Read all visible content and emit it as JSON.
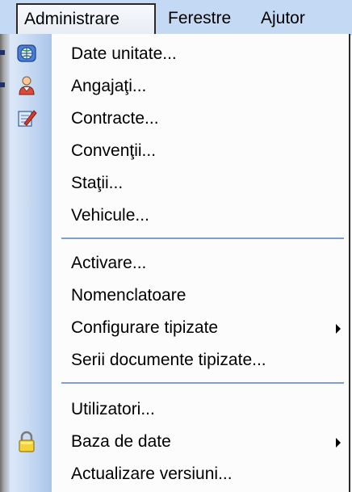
{
  "menubar": {
    "items": [
      {
        "label": "Administrare",
        "active": true
      },
      {
        "label": "Ferestre"
      },
      {
        "label": "Ajutor"
      }
    ]
  },
  "menu": {
    "items": [
      {
        "label": "Date unitate...",
        "icon": "globe-icon"
      },
      {
        "label": "Angajaţi...",
        "icon": "user-icon"
      },
      {
        "label": "Contracte...",
        "icon": "edit-document-icon"
      },
      {
        "label": "Convenţii..."
      },
      {
        "label": "Staţii..."
      },
      {
        "label": "Vehicule..."
      },
      {
        "label": "Activare..."
      },
      {
        "label": "Nomenclatoare"
      },
      {
        "label": "Configurare tipizate",
        "submenu": true
      },
      {
        "label": "Serii documente tipizate..."
      },
      {
        "label": "Utilizatori...",
        "icon": "lock-icon"
      },
      {
        "label": "Baza de date",
        "submenu": true
      },
      {
        "label": "Actualizare versiuni..."
      }
    ]
  },
  "colors": {
    "menubar_bg": "#c4d9f3",
    "gutter": "#aac5ea",
    "separator": "#7f9fd1"
  }
}
